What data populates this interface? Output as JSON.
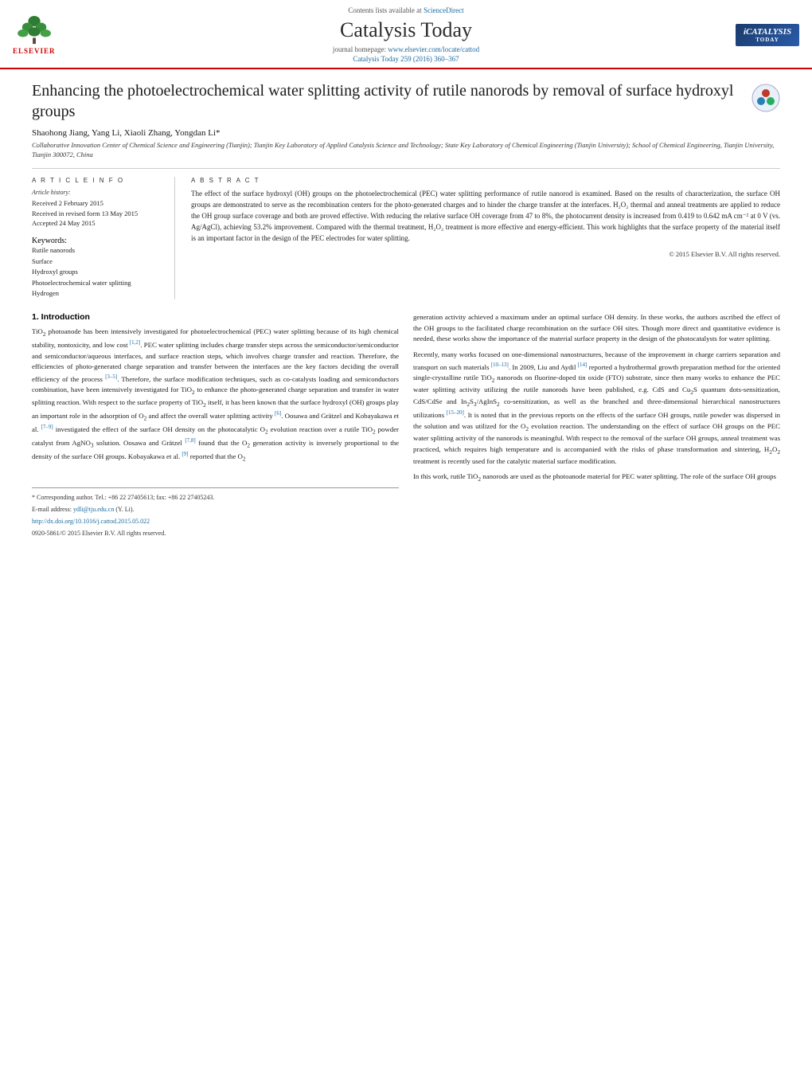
{
  "header": {
    "journal_ref": "Catalysis Today 259 (2016) 360–367",
    "sciencedirect_label": "Contents lists available at",
    "sciencedirect_link": "ScienceDirect",
    "journal_title": "Catalysis Today",
    "homepage_label": "journal homepage:",
    "homepage_link": "www.elsevier.com/locate/cattod",
    "elsevier_label": "ELSEVIER",
    "logo_title": "iCATALYSIS",
    "logo_sub": "TODAY"
  },
  "article": {
    "title": "Enhancing the photoelectrochemical water splitting activity of rutile nanorods by removal of surface hydroxyl groups",
    "authors": "Shaohong Jiang, Yang Li, Xiaoli Zhang, Yongdan Li*",
    "corresponding_marker": "*",
    "affiliation": "Collaborative Innovation Center of Chemical Science and Engineering (Tianjin); Tianjin Key Laboratory of Applied Catalysis Science and Technology; State Key Laboratory of Chemical Engineering (Tianjin University); School of Chemical Engineering, Tianjin University, Tianjin 300072, China",
    "article_info": {
      "label": "A R T I C L E   I N F O",
      "history_label": "Article history:",
      "received": "Received 2 February 2015",
      "revised": "Received in revised form 13 May 2015",
      "accepted": "Accepted 24 May 2015",
      "keywords_label": "Keywords:",
      "keywords": [
        "Rutile nanorods",
        "Surface",
        "Hydroxyl groups",
        "Photoelectrochemical water splitting",
        "Hydrogen"
      ]
    },
    "abstract": {
      "label": "A B S T R A C T",
      "text": "The effect of the surface hydroxyl (OH) groups on the photoelectrochemical (PEC) water splitting performance of rutile nanorod is examined. Based on the results of characterization, the surface OH groups are demonstrated to serve as the recombination centers for the photo-generated charges and to hinder the charge transfer at the interfaces. H₂O₂ thermal and anneal treatments are applied to reduce the OH group surface coverage and both are proved effective. With reducing the relative surface OH coverage from 47 to 8%, the photocurrent density is increased from 0.419 to 0.642 mA cm⁻² at 0 V (vs. Ag/AgCl), achieving 53.2% improvement. Compared with the thermal treatment, H₂O₂ treatment is more effective and energy-efficient. This work highlights that the surface property of the material itself is an important factor in the design of the PEC electrodes for water splitting.",
      "copyright": "© 2015 Elsevier B.V. All rights reserved."
    }
  },
  "main_content": {
    "section1_heading": "1.  Introduction",
    "left_column_text": [
      "TiO₂ photoanode has been intensively investigated for photoelectrochemical (PEC) water splitting because of its high chemical stability, nontoxicity, and low cost [1,2]. PEC water splitting includes charge transfer steps across the semiconductor/semiconductor and semiconductor/aqueous interfaces, and surface reaction steps, which involves charge transfer and reaction. Therefore, the efficiencies of photo-generated charge separation and transfer between the interfaces are the key factors deciding the overall efficiency of the process [3–5]. Therefore, the surface modification techniques, such as co-catalysts loading and semiconductors combination, have been intensively investigated for TiO₂ to enhance the photo-generated charge separation and transfer in water splitting reaction. With respect to the surface property of TiO₂ itself, it has been known that the surface hydroxyl (OH) groups play an important role in the adsorption of O₂ and affect the overall water splitting activity [6]. Oosawa and Grätzel and Kobayakawa et al. [7–9] investigated the effect of the surface OH density on the photocatalytic O₂ evolution reaction over a rutile TiO₂ powder catalyst from AgNO₃ solution. Oosawa and Grätzel [7,8] found that the O₂ generation activity is inversely proportional to the density of the surface OH groups. Kobayakawa et al. [9] reported that the O₂"
    ],
    "right_column_text": [
      "generation activity achieved a maximum under an optimal surface OH density. In these works, the authors ascribed the effect of the OH groups to the facilitated charge recombination on the surface OH sites. Though more direct and quantitative evidence is needed, these works show the importance of the material surface property in the design of the photocatalysts for water splitting.",
      "Recently, many works focused on one-dimensional nanostructures, because of the improvement in charge carriers separation and transport on such materials [10–13]. In 2009, Liu and Aydil [14] reported a hydrothermal growth preparation method for the oriented single-crystalline rutile TiO₂ nanorods on fluorine-doped tin oxide (FTO) substrate, since then many works to enhance the PEC water splitting activity utilizing the rutile nanorods have been published, e.g. CdS and Cu₂S quantum dots-sensitization, CdS/CdSe and In₂S₃/AgInS₂ co-sensitization, as well as the branched and three-dimensional hierarchical nanostructures utilizations [15–20]. It is noted that in the previous reports on the effects of the surface OH groups, rutile powder was dispersed in the solution and was utilized for the O₂ evolution reaction. The understanding on the effect of surface OH groups on the PEC water splitting activity of the nanorods is meaningful. With respect to the removal of the surface OH groups, anneal treatment was practiced, which requires high temperature and is accompanied with the risks of phase transformation and sintering, H₂O₂ treatment is recently used for the catalytic material surface modification.",
      "In this work, rutile TiO₂ nanorods are used as the photoanode material for PEC water splitting. The role of the surface OH groups"
    ]
  },
  "footer": {
    "corresponding_note": "* Corresponding author. Tel.: +86 22 27405613; fax: +86 22 27405243.",
    "email_label": "E-mail address:",
    "email": "ydli@tju.edu.cn",
    "email_suffix": "(Y. Li).",
    "doi_label": "http://dx.doi.org/10.1016/j.cattod.2015.05.022",
    "issn": "0920-5861/© 2015 Elsevier B.V. All rights reserved."
  }
}
